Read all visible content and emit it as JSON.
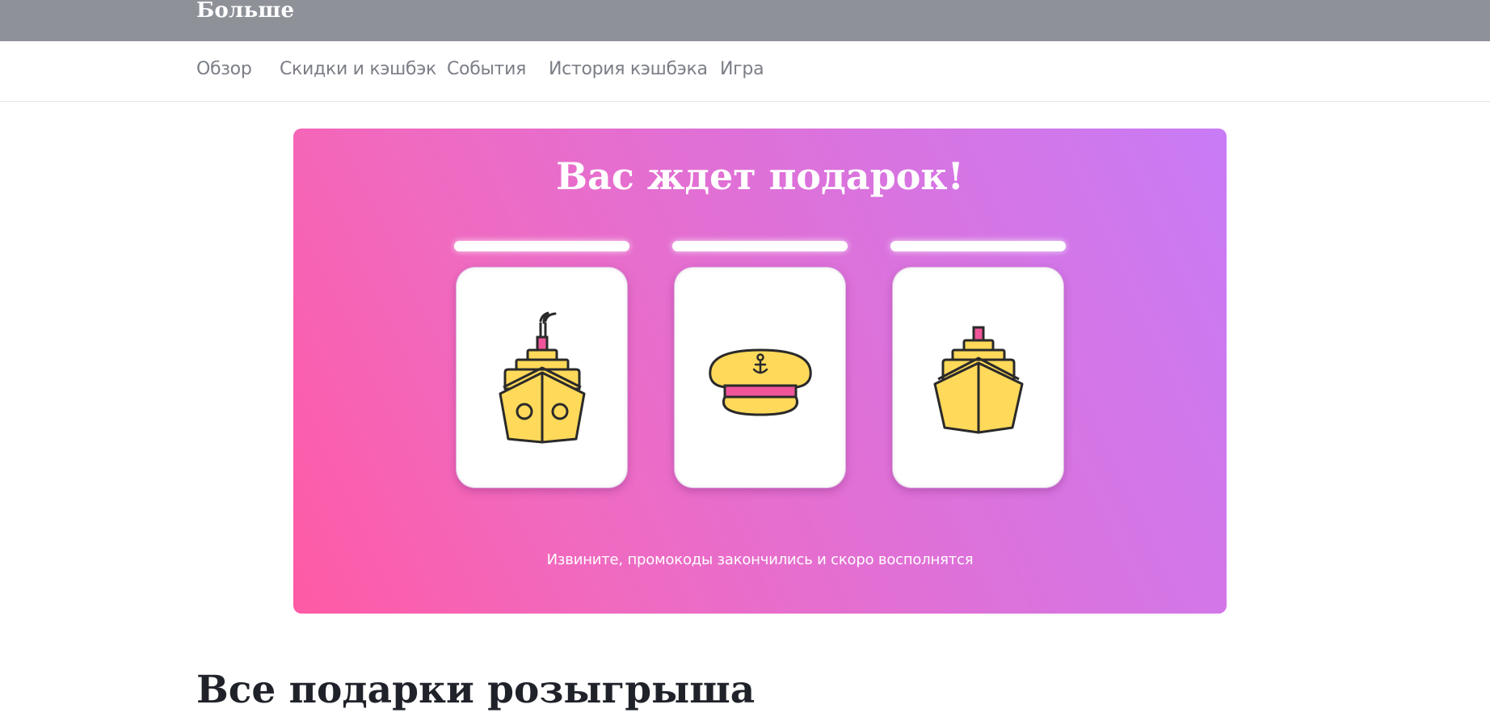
{
  "header": {
    "title": "Больше"
  },
  "tabs": [
    {
      "label": "Обзор"
    },
    {
      "label": "Скидки и кэшбэк"
    },
    {
      "label": "События"
    },
    {
      "label": "История кэшбэка"
    },
    {
      "label": "Игра"
    }
  ],
  "banner": {
    "title": "Вас ждет подарок!",
    "note": "Извините, промокоды закончились и скоро восполнятся",
    "cards": [
      {
        "icon": "ship-with-smoke-icon"
      },
      {
        "icon": "captain-hat-icon"
      },
      {
        "icon": "ship-icon"
      }
    ]
  },
  "section": {
    "title": "Все подарки розыгрыша"
  },
  "colors": {
    "topbar": "#8f9199",
    "gradient_start": "#ff5aa5",
    "gradient_end": "#c87bf6",
    "icon_fill": "#ffd95a",
    "icon_accent": "#f0559a"
  }
}
